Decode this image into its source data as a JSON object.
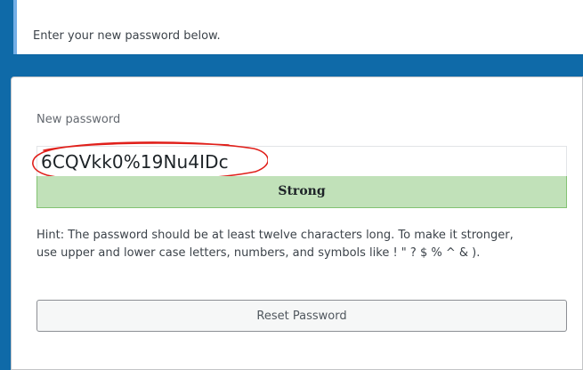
{
  "message": {
    "text": "Enter your new password below."
  },
  "form": {
    "password_label": "New password",
    "password_value": "6CQVkk0%19Nu4IDc",
    "strength_label": "Strong",
    "hint_line1": "Hint: The password should be at least twelve characters long. To make it stronger,",
    "hint_line2": "use upper and lower case letters, numbers, and symbols like ! \" ? $ % ^ & ).",
    "reset_button_label": "Reset Password"
  },
  "colors": {
    "background_blue": "#0f6aa8",
    "strength_strong": "#c1e1b9",
    "annotation_red": "#e0201b"
  }
}
